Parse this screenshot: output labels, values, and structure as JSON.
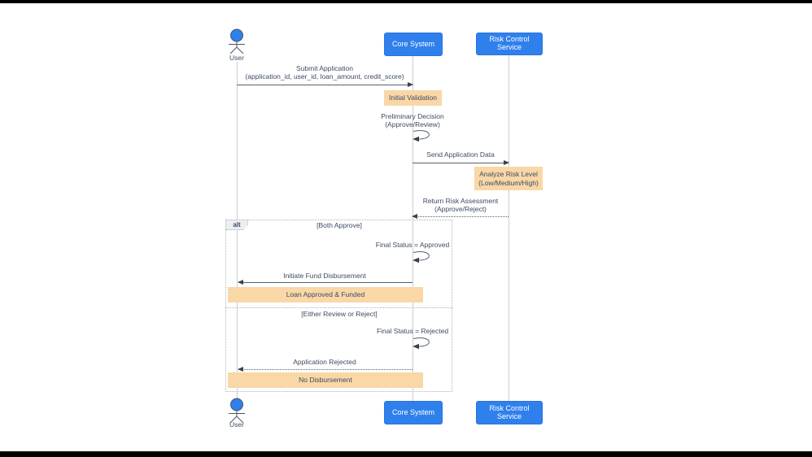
{
  "actors": {
    "user": {
      "label": "User"
    },
    "core": {
      "label": "Core System"
    },
    "risk": {
      "label": "Risk Control Service"
    }
  },
  "messages": {
    "submit": {
      "label": "Submit Application",
      "params": "(application_id, user_id, loan_amount, credit_score)"
    },
    "send_data": {
      "label": "Send Application Data"
    },
    "return_risk": {
      "label": "Return Risk Assessment",
      "params": "(Approve/Reject)"
    },
    "initiate_fund": {
      "label": "Initiate Fund Disbursement"
    },
    "app_rejected": {
      "label": "Application Rejected"
    }
  },
  "self_messages": {
    "preliminary": {
      "label": "Preliminary Decision",
      "params": "(Approve/Review)"
    },
    "final_approved": {
      "label": "Final Status = Approved"
    },
    "final_rejected": {
      "label": "Final Status = Rejected"
    }
  },
  "notes": {
    "initial_validation": {
      "label": "Initial Validation"
    },
    "analyze_risk": {
      "label": "Analyze Risk Level",
      "params": "(Low/Medium/High)"
    },
    "loan_funded": {
      "label": "Loan Approved & Funded"
    },
    "no_disbursement": {
      "label": "No Disbursement"
    }
  },
  "alt": {
    "label": "alt",
    "conditions": {
      "both_approve": "[Both Approve]",
      "either_reject": "[Either Review or Reject]"
    }
  },
  "colors": {
    "participant_fill": "#2F80ED",
    "participant_text": "#FFFFFF",
    "note_fill": "#F9D7A6",
    "text": "#3D4A66",
    "line": "#566070",
    "lifeline": "#CBCED6",
    "frame_border": "#AEB2BB"
  }
}
